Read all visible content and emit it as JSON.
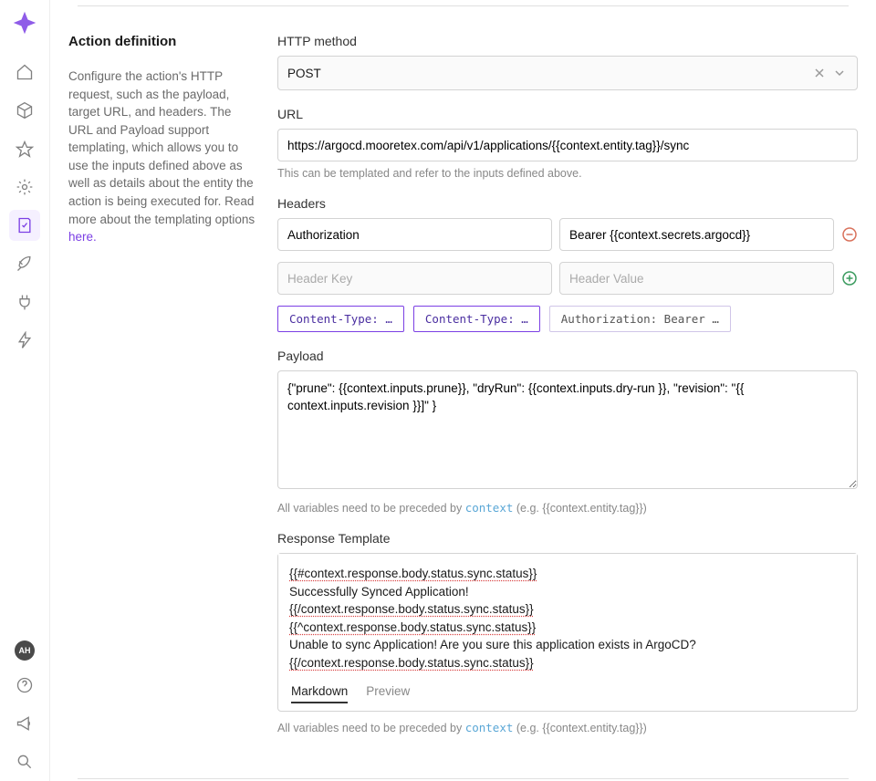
{
  "sidebar": {
    "avatar": "AH"
  },
  "section": {
    "title": "Action definition",
    "help_pre": "Configure the action's HTTP request, such as the payload, target URL, and headers. The URL and Payload support templating, which allows you to use the inputs defined above as well as details about the entity the action is being executed for. Read more about the templating options ",
    "help_link": "here."
  },
  "http_method": {
    "label": "HTTP method",
    "value": "POST"
  },
  "url": {
    "label": "URL",
    "value": "https://argocd.mooretex.com/api/v1/applications/{{context.entity.tag}}/sync",
    "helper": "This can be templated and refer to the inputs defined above."
  },
  "headers": {
    "label": "Headers",
    "rows": [
      {
        "key": "Authorization",
        "value": "Bearer {{context.secrets.argocd}}"
      }
    ],
    "empty_key_placeholder": "Header Key",
    "empty_value_placeholder": "Header Value",
    "chips": [
      "Content-Type: …",
      "Content-Type: …",
      "Authorization: Bearer …"
    ]
  },
  "payload": {
    "label": "Payload",
    "value": "{\"prune\": {{context.inputs.prune}}, \"dryRun\": {{context.inputs.dry-run }}, \"revision\": \"{{ context.inputs.revision }}]\" }"
  },
  "context_note": {
    "pre": "All variables need to be preceded by ",
    "code": "context",
    "post": " (e.g. {{context.entity.tag}})"
  },
  "response": {
    "label": "Response Template",
    "lines": [
      {
        "text": "{{#context.response.body.status.sync.status}}",
        "squiggle": true
      },
      {
        "text": "Successfully Synced Application!",
        "squiggle": false
      },
      {
        "text": "{{/context.response.body.status.sync.status}}",
        "squiggle": true
      },
      {
        "text": "{{^context.response.body.status.sync.status}}",
        "squiggle": true
      },
      {
        "text": "Unable to sync Application! Are you sure this application exists in ArgoCD?",
        "squiggle": false
      },
      {
        "text": "{{/context.response.body.status.sync.status}}",
        "squiggle": true
      }
    ],
    "tabs": {
      "markdown": "Markdown",
      "preview": "Preview"
    }
  }
}
